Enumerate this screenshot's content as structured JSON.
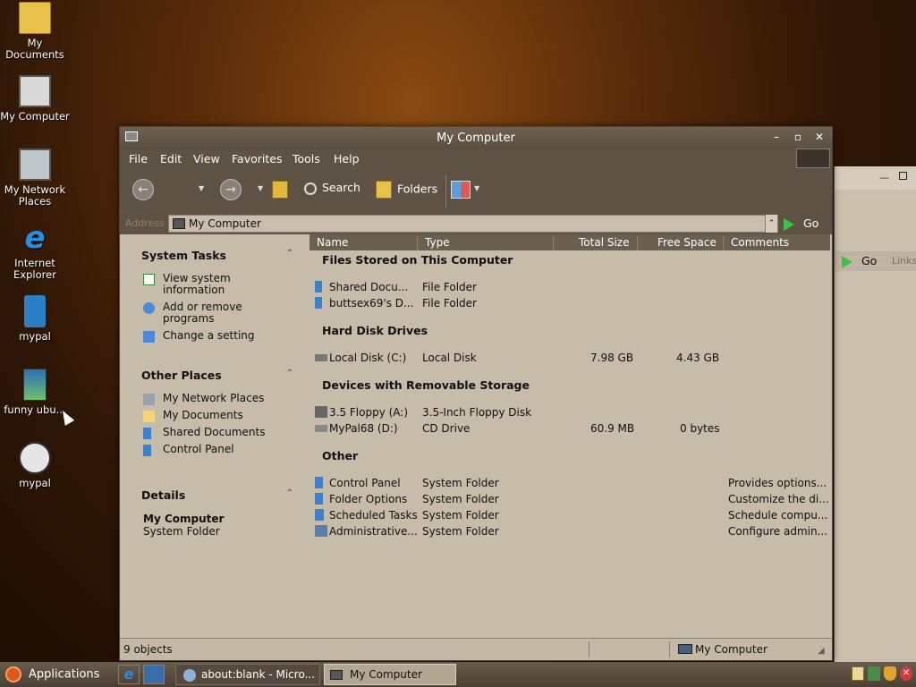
{
  "desktop": {
    "icons": [
      {
        "label": "My Documents"
      },
      {
        "label": "My Computer"
      },
      {
        "label": "My Network Places"
      },
      {
        "label": "Internet Explorer"
      },
      {
        "label": "mypal"
      },
      {
        "label": "funny ubu..."
      },
      {
        "label": "mypal"
      }
    ]
  },
  "window": {
    "title": "My Computer",
    "menu": [
      "File",
      "Edit",
      "View",
      "Favorites",
      "Tools",
      "Help"
    ],
    "toolbar": {
      "search": "Search",
      "folders": "Folders"
    },
    "address": {
      "label": "Address",
      "value": "My Computer",
      "go": "Go"
    },
    "sidebar": {
      "system_tasks": {
        "title": "System Tasks",
        "items": [
          "View system information",
          "Add or remove programs",
          "Change a setting"
        ]
      },
      "other_places": {
        "title": "Other Places",
        "items": [
          "My Network Places",
          "My Documents",
          "Shared Documents",
          "Control Panel"
        ]
      },
      "details": {
        "title": "Details",
        "name": "My Computer",
        "type": "System Folder"
      }
    },
    "columns": [
      "Name",
      "Type",
      "Total Size",
      "Free Space",
      "Comments"
    ],
    "groups": [
      {
        "title": "Files Stored on This Computer",
        "rows": [
          {
            "name": "Shared Docu...",
            "type": "File Folder",
            "total": "",
            "free": "",
            "comments": ""
          },
          {
            "name": "buttsex69's D...",
            "type": "File Folder",
            "total": "",
            "free": "",
            "comments": ""
          }
        ]
      },
      {
        "title": "Hard Disk Drives",
        "rows": [
          {
            "name": "Local Disk (C:)",
            "type": "Local Disk",
            "total": "7.98 GB",
            "free": "4.43 GB",
            "comments": ""
          }
        ]
      },
      {
        "title": "Devices with Removable Storage",
        "rows": [
          {
            "name": "3.5 Floppy (A:)",
            "type": "3.5-Inch Floppy Disk",
            "total": "",
            "free": "",
            "comments": ""
          },
          {
            "name": "MyPal68 (D:)",
            "type": "CD Drive",
            "total": "60.9 MB",
            "free": "0 bytes",
            "comments": ""
          }
        ]
      },
      {
        "title": "Other",
        "rows": [
          {
            "name": "Control Panel",
            "type": "System Folder",
            "total": "",
            "free": "",
            "comments": "Provides options..."
          },
          {
            "name": "Folder Options",
            "type": "System Folder",
            "total": "",
            "free": "",
            "comments": "Customize the di..."
          },
          {
            "name": "Scheduled Tasks",
            "type": "System Folder",
            "total": "",
            "free": "",
            "comments": "Schedule compu..."
          },
          {
            "name": "Administrative...",
            "type": "System Folder",
            "total": "",
            "free": "",
            "comments": "Configure admin..."
          }
        ]
      }
    ],
    "status": {
      "count": "9 objects",
      "location": "My Computer"
    }
  },
  "bg_window": {
    "go": "Go",
    "links": "Links"
  },
  "taskbar": {
    "applications": "Applications",
    "tasks": [
      {
        "label": "about:blank - Micro..."
      },
      {
        "label": "My Computer"
      }
    ]
  }
}
